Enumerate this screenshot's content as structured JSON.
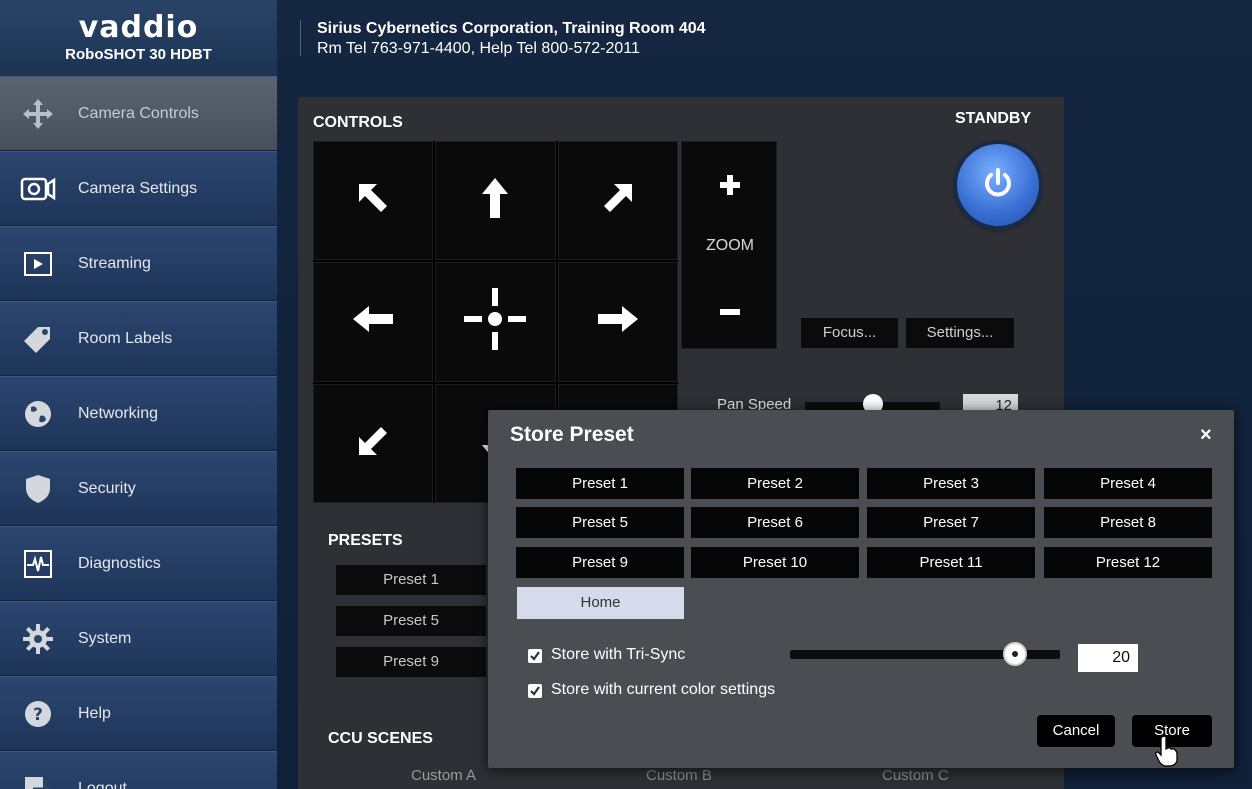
{
  "brand": {
    "logo": "vaddio",
    "model": "RoboSHOT 30 HDBT"
  },
  "header": {
    "line1": "Sirius Cybernetics Corporation, Training Room 404",
    "line2": "Rm Tel 763-971-4400, Help Tel 800-572-2011"
  },
  "sidebar": {
    "items": [
      {
        "label": "Camera Controls",
        "icon": "move-arrows-icon",
        "active": true
      },
      {
        "label": "Camera Settings",
        "icon": "camera-icon"
      },
      {
        "label": "Streaming",
        "icon": "play-icon"
      },
      {
        "label": "Room Labels",
        "icon": "tag-icon"
      },
      {
        "label": "Networking",
        "icon": "globe-icon"
      },
      {
        "label": "Security",
        "icon": "shield-icon"
      },
      {
        "label": "Diagnostics",
        "icon": "pulse-icon"
      },
      {
        "label": "System",
        "icon": "gear-icon"
      },
      {
        "label": "Help",
        "icon": "help-icon"
      },
      {
        "label": "Logout",
        "icon": "logout-icon"
      }
    ]
  },
  "controls": {
    "title": "CONTROLS",
    "standby_label": "STANDBY",
    "zoom_label": "ZOOM",
    "focus_button": "Focus...",
    "settings_button": "Settings...",
    "pan_speed_label": "Pan Speed",
    "pan_speed_value": "12"
  },
  "presets_section": {
    "title": "PRESETS",
    "visible": [
      "Preset 1",
      "Preset 5",
      "Preset 9"
    ]
  },
  "ccu_section": {
    "title": "CCU SCENES",
    "visible": [
      "Custom A",
      "Custom B",
      "Custom C"
    ]
  },
  "modal": {
    "title": "Store Preset",
    "close_symbol": "×",
    "presets": [
      "Preset 1",
      "Preset 2",
      "Preset 3",
      "Preset 4",
      "Preset 5",
      "Preset 6",
      "Preset 7",
      "Preset 8",
      "Preset 9",
      "Preset 10",
      "Preset 11",
      "Preset 12"
    ],
    "home_label": "Home",
    "tri_sync_label": "Store with Tri-Sync",
    "tri_sync_checked": true,
    "color_label": "Store with current color settings",
    "color_checked": true,
    "speed_value": "20",
    "cancel_label": "Cancel",
    "store_label": "Store"
  },
  "colors": {
    "standby_blue": "#3c72d6",
    "panel": "#2e3035",
    "modal": "#4a4d52",
    "sidebar_active": "#5a6470"
  }
}
